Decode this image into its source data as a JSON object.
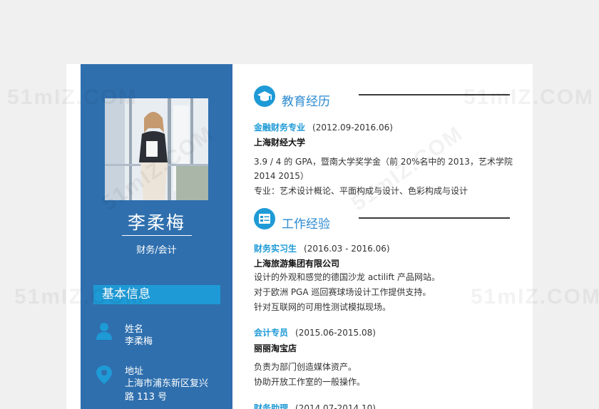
{
  "watermark": "51mIZ.COM",
  "profile": {
    "name": "李柔梅",
    "role": "财务/会计"
  },
  "basic_info": {
    "title": "基本信息",
    "name_label": "姓名",
    "name_value": "李柔梅",
    "address_label": "地址",
    "address_value": "上海市浦东新区复兴路 113 号"
  },
  "education": {
    "title": "教育经历",
    "entries": [
      {
        "major": "金融财务专业",
        "dates": "(2012.09-2016.06)",
        "school": "上海财经大学",
        "desc_1": "3.9 / 4 的 GPA，暨南大学奖学金（前 20%名中的 2013，艺术学院 2014 2015）",
        "desc_2": "专业：艺术设计概论、平面构成与设计、色彩构成与设计"
      }
    ]
  },
  "work": {
    "title": "工作经验",
    "entries": [
      {
        "position": "财务实习生",
        "dates": "(2016.03 - 2016.06)",
        "company": "上海旅游集团有限公司",
        "lines": [
          "设计的外观和感觉的德国沙龙 actilift 产品网站。",
          "对于欧洲 PGA 巡回赛球场设计工作提供支持。",
          "针对互联网的可用性测试模拟现场。"
        ]
      },
      {
        "position": "会计专员",
        "dates": "(2015.06-2015.08)",
        "company": "丽丽淘宝店",
        "lines": [
          "负责为部门创造媒体资产。",
          "协助开放工作室的一般操作。"
        ]
      },
      {
        "position": "财务助理",
        "dates": "(2014.07-2014.10)"
      }
    ]
  },
  "colors": {
    "sidebar": "#2f6fae",
    "accent": "#1e9ad6",
    "heading": "#2b8ad0"
  }
}
